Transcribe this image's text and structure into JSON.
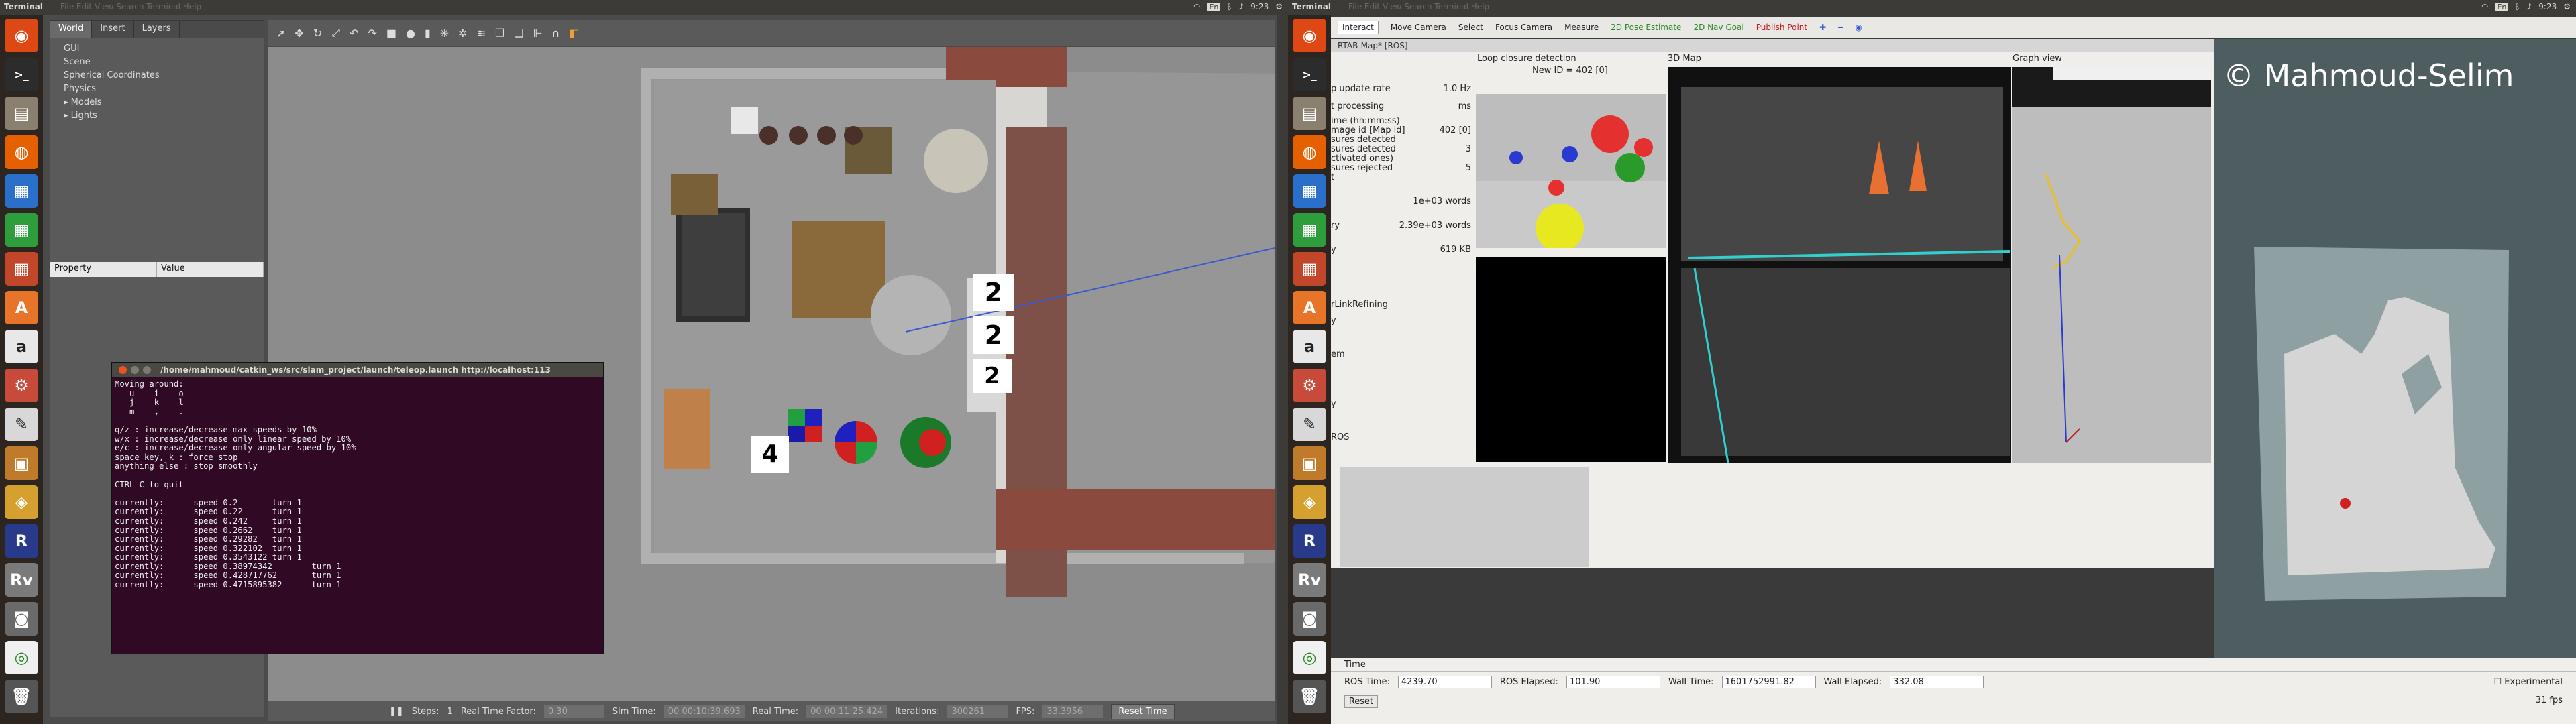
{
  "left_panel_bar": {
    "title": "Terminal",
    "menu": "File Edit View Search Terminal Help",
    "time": "9:23",
    "lang": "En"
  },
  "right_panel_bar": {
    "title": "Terminal",
    "menu": "File Edit View Search Terminal Help",
    "time": "9:23",
    "lang": "En"
  },
  "gazebo": {
    "tabs": [
      "World",
      "Insert",
      "Layers"
    ],
    "tree": [
      "GUI",
      "Scene",
      "Spherical Coordinates",
      "Physics",
      "Models",
      "Lights"
    ],
    "prop_headers": [
      "Property",
      "Value"
    ],
    "bottom": {
      "steps_label": "Steps:",
      "steps_value": "1",
      "rtf_label": "Real Time Factor:",
      "rtf_value": "0.30",
      "sim_label": "Sim Time:",
      "sim_value": "00 00:10:39.693",
      "real_label": "Real Time:",
      "real_value": "00 00:11:25.424",
      "iter_label": "Iterations:",
      "iter_value": "300261",
      "fps_label": "FPS:",
      "fps_value": "33.3956",
      "reset": "Reset Time"
    },
    "box_labels": [
      "4",
      "2",
      "2",
      "2"
    ]
  },
  "terminal": {
    "title": "/home/mahmoud/catkin_ws/src/slam_project/launch/teleop.launch http://localhost:113",
    "lines": [
      "Moving around:",
      "   u    i    o",
      "   j    k    l",
      "   m    ,    .",
      "",
      "q/z : increase/decrease max speeds by 10%",
      "w/x : increase/decrease only linear speed by 10%",
      "e/c : increase/decrease only angular speed by 10%",
      "space key, k : force stop",
      "anything else : stop smoothly",
      "",
      "CTRL-C to quit",
      "",
      "currently:      speed 0.2       turn 1",
      "currently:      speed 0.22      turn 1",
      "currently:      speed 0.242     turn 1",
      "currently:      speed 0.2662    turn 1",
      "currently:      speed 0.29282   turn 1",
      "currently:      speed 0.322102  turn 1",
      "currently:      speed 0.3543122 turn 1",
      "currently:      speed 0.38974342        turn 1",
      "currently:      speed 0.428717762       turn 1",
      "currently:      speed 0.4715895382      turn 1"
    ]
  },
  "rviz": {
    "tools": [
      "Interact",
      "Move Camera",
      "Select",
      "Focus Camera",
      "Measure",
      "2D Pose Estimate",
      "2D Nav Goal",
      "Publish Point"
    ],
    "rtab_title": "RTAB-Map* [ROS]",
    "panels": [
      "Loop closure detection",
      "3D Map",
      "Graph view"
    ],
    "new_id": "New ID = 402 [0]",
    "stats": [
      {
        "label": "p update rate",
        "value": "1.0 Hz"
      },
      {
        "label": "t processing",
        "value": "ms"
      },
      {
        "label": "ime (hh:mm:ss)",
        "value": ""
      },
      {
        "label": "mage id [Map id]",
        "value": "402 [0]"
      },
      {
        "label": "sures detected",
        "value": ""
      },
      {
        "label": "sures detected",
        "value": "3"
      },
      {
        "label": "ctivated ones)",
        "value": ""
      },
      {
        "label": "sures rejected",
        "value": "5"
      },
      {
        "label": "t",
        "value": ""
      },
      {
        "label": "",
        "value": "1e+03   words"
      },
      {
        "label": "ry",
        "value": "2.39e+03  words"
      },
      {
        "label": "y",
        "value": "619   KB"
      }
    ],
    "side_items": [
      "rLinkRefining",
      "y",
      "em",
      "y",
      "ROS"
    ],
    "watermark": "© Mahmoud-Selim",
    "time_panel": "Time",
    "ros_time_label": "ROS Time:",
    "ros_time": "4239.70",
    "ros_elapsed_label": "ROS Elapsed:",
    "ros_elapsed": "101.90",
    "wall_time_label": "Wall Time:",
    "wall_time": "1601752991.82",
    "wall_elapsed_label": "Wall Elapsed:",
    "wall_elapsed": "332.08",
    "experimental": "Experimental",
    "reset": "Reset",
    "fps": "31 fps"
  }
}
